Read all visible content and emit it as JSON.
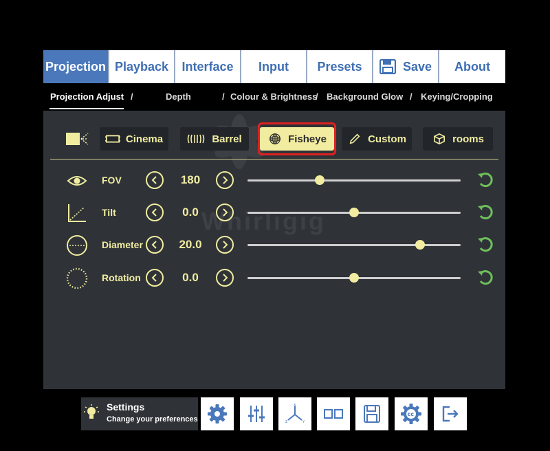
{
  "tabs": [
    {
      "label": "Projection",
      "active": true
    },
    {
      "label": "Playback"
    },
    {
      "label": "Interface"
    },
    {
      "label": "Input"
    },
    {
      "label": "Presets"
    },
    {
      "label": "Save",
      "icon": "floppy-icon"
    },
    {
      "label": "About"
    }
  ],
  "subnav": {
    "items": [
      "Projection Adjust",
      "Depth",
      "Colour & Brightness",
      "Background Glow",
      "Keying/Cropping"
    ],
    "active": "Projection Adjust"
  },
  "watermark": "Whirligig",
  "modes": [
    {
      "label": "Cinema",
      "icon": "cinema-icon"
    },
    {
      "label": "Barrel",
      "icon": "barrel-icon"
    },
    {
      "label": "Fisheye",
      "icon": "fisheye-icon",
      "selected": true
    },
    {
      "label": "Custom",
      "icon": "pencil-icon"
    },
    {
      "label": "rooms",
      "icon": "cube-icon"
    }
  ],
  "controls": [
    {
      "label": "FOV",
      "value": "180",
      "level": 0.34,
      "icon": "eye-icon"
    },
    {
      "label": "Tilt",
      "value": "0.0",
      "level": 0.5,
      "icon": "tilt-icon"
    },
    {
      "label": "Diameter",
      "value": "20.0",
      "level": 0.81,
      "icon": "diameter-icon"
    },
    {
      "label": "Rotation",
      "value": "0.0",
      "level": 0.5,
      "icon": "rotation-icon"
    }
  ],
  "settings": {
    "title": "Settings",
    "subtitle": "Change your preferences"
  },
  "bottom_buttons": [
    "gear-icon",
    "sliders-icon",
    "axes-icon",
    "dual-view-icon",
    "floppy-icon",
    "cc-gear-icon",
    "exit-icon"
  ],
  "colors": {
    "accent": "#f1eca0",
    "tab_active": "#4a78bb",
    "panel": "#2f3338",
    "reset": "#6fbf5a",
    "selection": "#e02020"
  }
}
